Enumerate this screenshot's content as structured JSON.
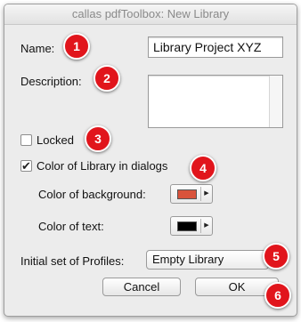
{
  "window": {
    "title": "callas pdfToolbox: New Library"
  },
  "form": {
    "name_label": "Name:",
    "name_value": "Library Project XYZ",
    "description_label": "Description:",
    "description_value": "",
    "locked_label": "Locked",
    "locked_checked": false,
    "color_in_dialogs_label": "Color of Library in dialogs",
    "color_in_dialogs_checked": true,
    "bg_color_label": "Color of background:",
    "bg_color": "#d9533b",
    "text_color_label": "Color of text:",
    "text_color": "#000000",
    "profiles_label": "Initial set of Profiles:",
    "profiles_value": "Empty Library"
  },
  "buttons": {
    "cancel": "Cancel",
    "ok": "OK"
  },
  "annotations": [
    "1",
    "2",
    "3",
    "4",
    "5",
    "6"
  ],
  "accent_color": "#e1151c"
}
